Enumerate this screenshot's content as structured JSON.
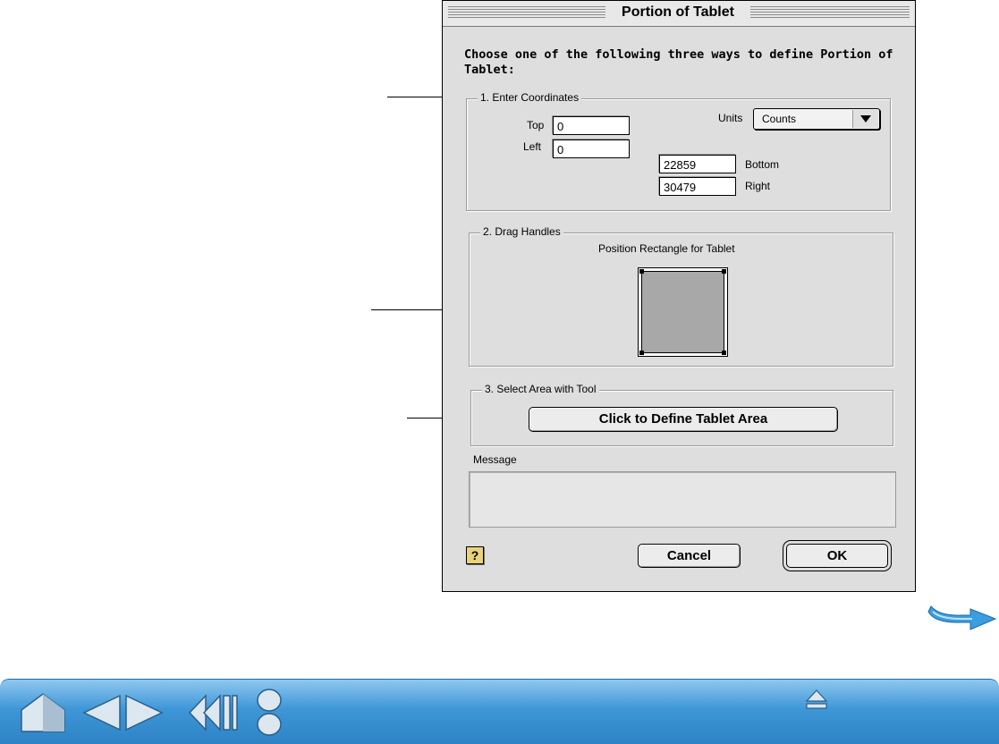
{
  "dialog": {
    "title": "Portion of Tablet",
    "instructions": "Choose one of the following three ways to define Portion of Tablet:",
    "section1": {
      "legend": "1. Enter Coordinates",
      "top_label": "Top",
      "top_value": "0",
      "left_label": "Left",
      "left_value": "0",
      "units_label": "Units",
      "units_value": "Counts",
      "bottom_value": "22859",
      "bottom_label": "Bottom",
      "right_value": "30479",
      "right_label": "Right"
    },
    "section2": {
      "legend": "2. Drag Handles",
      "caption": "Position Rectangle for Tablet"
    },
    "section3": {
      "legend": "3. Select Area with Tool",
      "button_label": "Click to Define Tablet Area"
    },
    "message_label": "Message",
    "message_text": "",
    "help_label": "?",
    "cancel_label": "Cancel",
    "ok_label": "OK"
  },
  "navigation": {
    "icons": [
      "home-icon",
      "previous-page-icon",
      "next-page-icon",
      "back-icon",
      "toggle-icon",
      "up-icon",
      "next-arrow-icon"
    ]
  },
  "colors": {
    "navbar": "#3f97d7",
    "nav_icon": "#dce7f0",
    "dialog_bg": "#dedede",
    "help_icon": "#e9d27a"
  }
}
